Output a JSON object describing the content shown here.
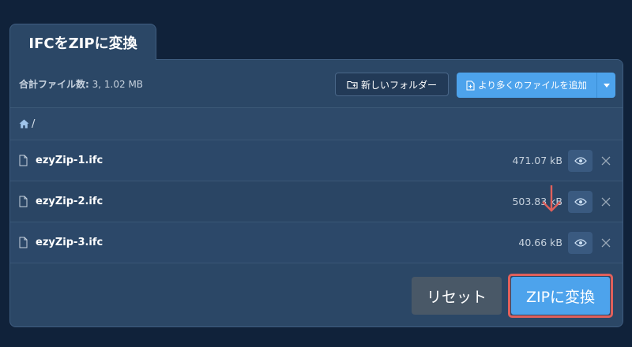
{
  "tab": {
    "title": "IFCをZIPに変換"
  },
  "toolbar": {
    "count_label": "合計ファイル数:",
    "count_value": "3, 1.02 MB",
    "new_folder_label": "新しいフォルダー",
    "add_files_label": "より多くのファイルを追加"
  },
  "breadcrumb": {
    "path": "/"
  },
  "files": [
    {
      "name": "ezyZip-1.ifc",
      "size": "471.07 kB"
    },
    {
      "name": "ezyZip-2.ifc",
      "size": "503.83 kB"
    },
    {
      "name": "ezyZip-3.ifc",
      "size": "40.66 kB"
    }
  ],
  "actions": {
    "reset_label": "リセット",
    "convert_label": "ZIPに変換"
  },
  "colors": {
    "background": "#10223a",
    "panel": "#2b4766",
    "accent": "#4da3ec",
    "highlight": "#e0605b",
    "reset": "#495867"
  },
  "icons": [
    "home-icon",
    "new-folder-icon",
    "add-file-icon",
    "chevron-down-icon",
    "file-icon",
    "eye-icon",
    "close-icon",
    "arrow-down-icon"
  ]
}
